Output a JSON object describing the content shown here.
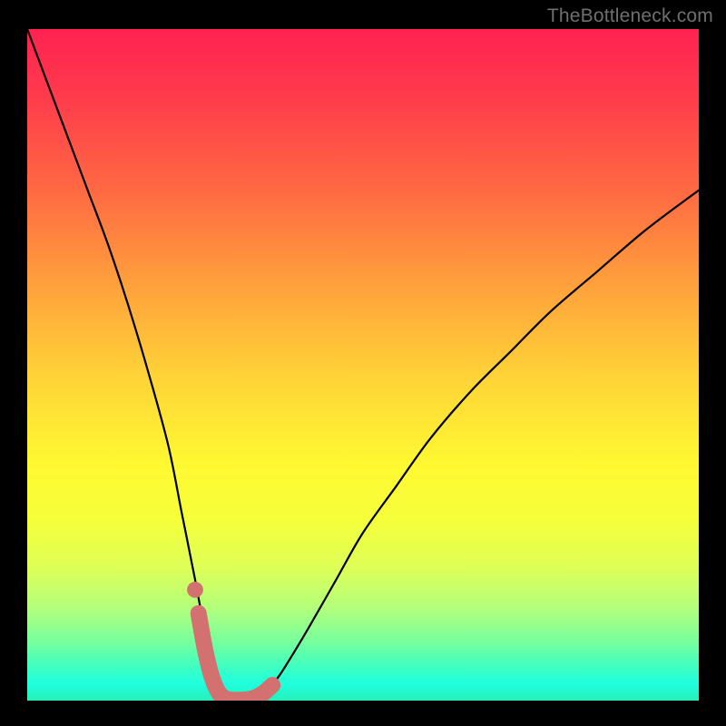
{
  "watermark": "TheBottleneck.com",
  "chart_data": {
    "type": "line",
    "title": "",
    "xlabel": "",
    "ylabel": "",
    "xlim": [
      0,
      100
    ],
    "ylim": [
      0,
      100
    ],
    "grid": false,
    "legend": false,
    "series": [
      {
        "name": "bottleneck-curve",
        "color": "#000000",
        "x": [
          0,
          3,
          6,
          9,
          12,
          15,
          18,
          21,
          23,
          25,
          26.5,
          27.5,
          28.5,
          29.5,
          30.5,
          32,
          33.5,
          35,
          37,
          39,
          42,
          46,
          50,
          55,
          60,
          66,
          72,
          78,
          85,
          92,
          100
        ],
        "y": [
          100,
          92,
          84,
          76,
          68,
          59,
          49,
          38,
          28,
          18,
          10,
          5,
          1.5,
          0.4,
          0.1,
          0.1,
          0.4,
          1.2,
          3,
          6,
          11,
          18,
          25,
          32,
          39,
          46,
          52,
          58,
          64,
          70,
          76
        ]
      },
      {
        "name": "highlight-segment",
        "color": "#d37070",
        "thick": true,
        "x": [
          25.5,
          26.5,
          27.5,
          28.5,
          29.5,
          30.5,
          32,
          33.5,
          35,
          36.5
        ],
        "y": [
          13,
          7.5,
          3.5,
          1.2,
          0.3,
          0.1,
          0.1,
          0.3,
          1.0,
          2.3
        ]
      }
    ],
    "markers": [
      {
        "name": "dot-left",
        "x": 25.0,
        "y": 16.5,
        "color": "#d37070",
        "r": 1.2
      }
    ]
  }
}
